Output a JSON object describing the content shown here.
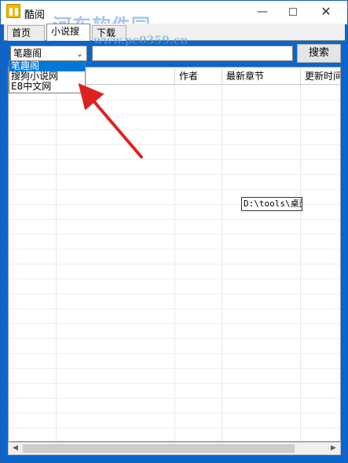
{
  "window": {
    "title": "酷阅",
    "watermark": "河东软件园",
    "watermark_url": "www.pc0359.cn",
    "minimize_glyph": "—",
    "close_glyph": "✕"
  },
  "tabs": [
    {
      "label": "首页"
    },
    {
      "label": "小说搜索"
    },
    {
      "label": "下载"
    }
  ],
  "search": {
    "source_selected": "笔趣阁",
    "keyword_value": "",
    "button_label": "搜索"
  },
  "dropdown": {
    "options": [
      "笔趣阁",
      "搜狗小说网",
      "E8中文网"
    ],
    "selected_index": 0
  },
  "grid": {
    "columns": [
      "",
      "",
      "作者",
      "最新章节",
      "更新时间"
    ],
    "cell_text": "D:\\tools\\桌面"
  },
  "scrollbar": {
    "left_glyph": "◀",
    "right_glyph": "▶"
  },
  "colors": {
    "window_bg": "#0a66cc",
    "selection": "#0078d7",
    "annotation_arrow": "#e02020"
  }
}
